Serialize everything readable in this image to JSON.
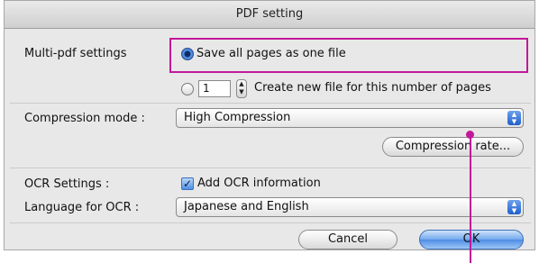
{
  "window": {
    "title": "PDF setting"
  },
  "multi_pdf": {
    "label": "Multi-pdf settings",
    "option_all_pages": "Save all pages as one file",
    "pages_count": "1",
    "option_split": "Create new file for this number of pages"
  },
  "compression": {
    "label": "Compression mode :",
    "selected": "High Compression",
    "rate_button": "Compression rate..."
  },
  "ocr": {
    "label": "OCR Settings :",
    "checkbox_label": "Add OCR information",
    "language_label": "Language for OCR :",
    "language_selected": "Japanese and English"
  },
  "buttons": {
    "cancel": "Cancel",
    "ok": "OK"
  },
  "colors": {
    "annotation": "#c2189a",
    "accent": "#4d8de6"
  },
  "icons": {
    "stepper": "up-down-arrows-icon",
    "select": "popup-arrows-icon",
    "check": "checkmark-icon"
  }
}
